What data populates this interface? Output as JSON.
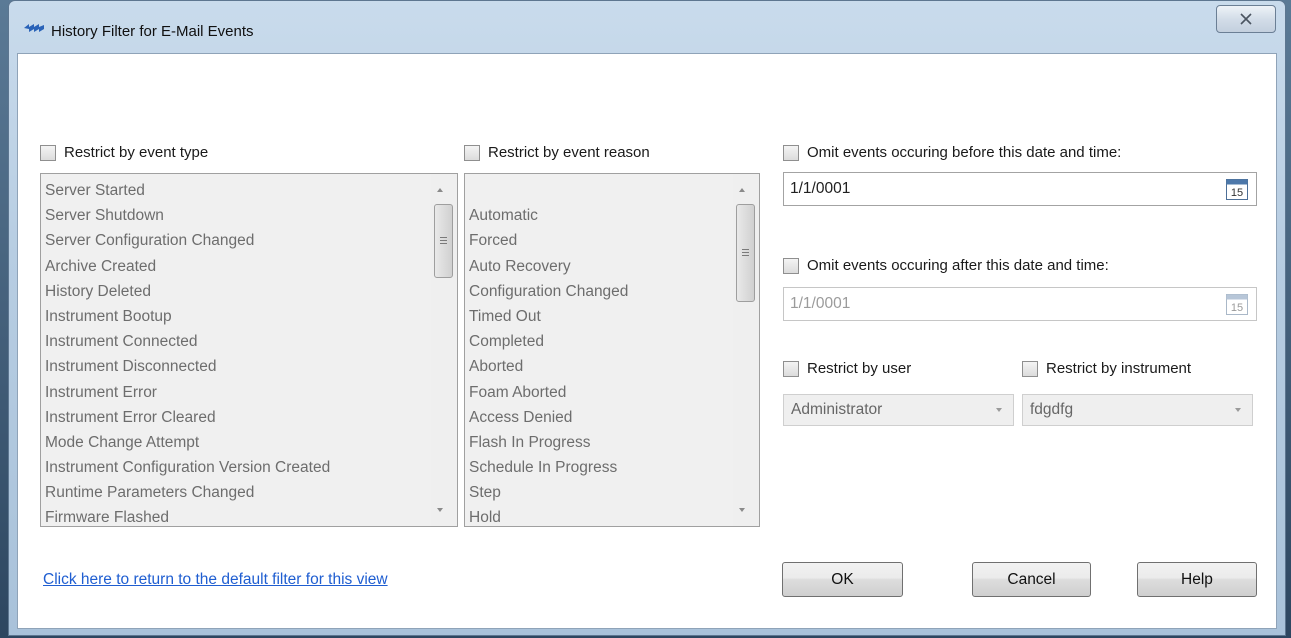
{
  "window": {
    "title": "History Filter for E-Mail Events"
  },
  "event_type": {
    "label": "Restrict by event type",
    "checked": false,
    "items": [
      "Server Started",
      "Server Shutdown",
      "Server Configuration Changed",
      "Archive Created",
      "History Deleted",
      "Instrument Bootup",
      "Instrument Connected",
      "Instrument Disconnected",
      "Instrument Error",
      "Instrument Error Cleared",
      "Mode Change Attempt",
      "Instrument Configuration Version Created",
      "Runtime Parameters Changed",
      "Firmware Flashed"
    ]
  },
  "event_reason": {
    "label": "Restrict by event reason",
    "checked": false,
    "items": [
      "",
      "Automatic",
      "Forced",
      "Auto Recovery",
      "Configuration Changed",
      "Timed Out",
      "Completed",
      "Aborted",
      "Foam Aborted",
      "Access Denied",
      "Flash In Progress",
      "Schedule In Progress",
      "Step",
      "Hold"
    ]
  },
  "before": {
    "label": "Omit events occuring before this date and time:",
    "checked": false,
    "value": "1/1/0001",
    "calendar_day": "15"
  },
  "after": {
    "label": "Omit events occuring after this date and time:",
    "checked": false,
    "value": "1/1/0001",
    "calendar_day": "15"
  },
  "user": {
    "label": "Restrict by user",
    "checked": false,
    "value": "Administrator"
  },
  "instrument": {
    "label": "Restrict by instrument",
    "checked": false,
    "value": "fdgdfg"
  },
  "footer": {
    "default_link": "Click here to return to the default filter for this view",
    "ok": "OK",
    "cancel": "Cancel",
    "help": "Help"
  }
}
